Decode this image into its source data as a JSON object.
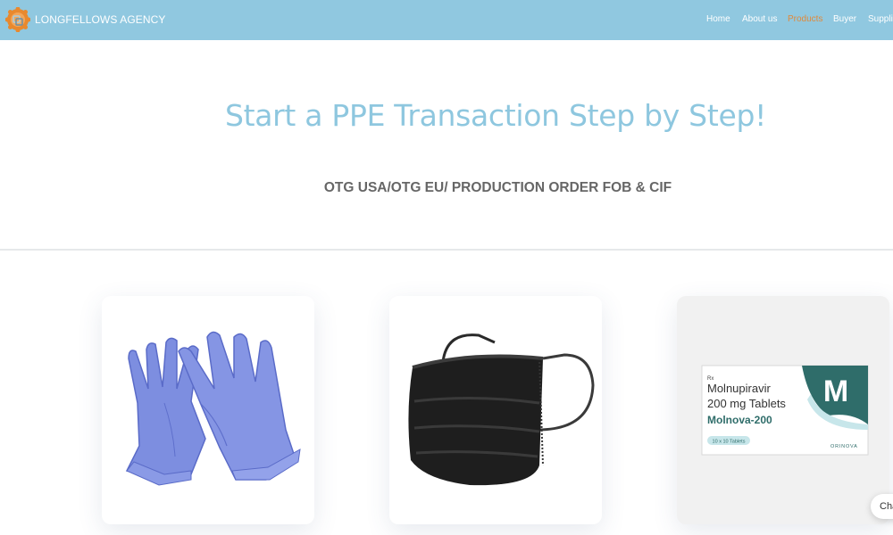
{
  "header": {
    "brand": "LONGFELLOWS AGENCY",
    "nav": [
      {
        "label": "Home",
        "active": false
      },
      {
        "label": "About us",
        "active": false
      },
      {
        "label": "Products",
        "active": true
      },
      {
        "label": "Buyer",
        "active": false
      },
      {
        "label": "Supplie",
        "active": false
      }
    ]
  },
  "hero": {
    "title": "Start a PPE Transaction Step by Step!",
    "subtitle": "OTG USA/OTG EU/ PRODUCTION ORDER FOB & CIF"
  },
  "products": [
    {
      "name": "gloves",
      "image": "nitrile-gloves"
    },
    {
      "name": "mask",
      "image": "face-mask"
    },
    {
      "name": "medicine",
      "image": "medicine-box",
      "box": {
        "rx": "Rx",
        "line1": "Molnupiravir",
        "line2": "200 mg Tablets",
        "brand": "Molnova-200",
        "count": "10 x 10 Tablets",
        "letter": "M",
        "maker": "ORINOVA"
      }
    }
  ],
  "chat": {
    "label": "Cha"
  },
  "colors": {
    "header": "#90c8e0",
    "accent": "#8ec7df",
    "active_nav": "#e08a3c",
    "box_teal": "#2f6d6a",
    "glove": "#7f8fe0"
  }
}
